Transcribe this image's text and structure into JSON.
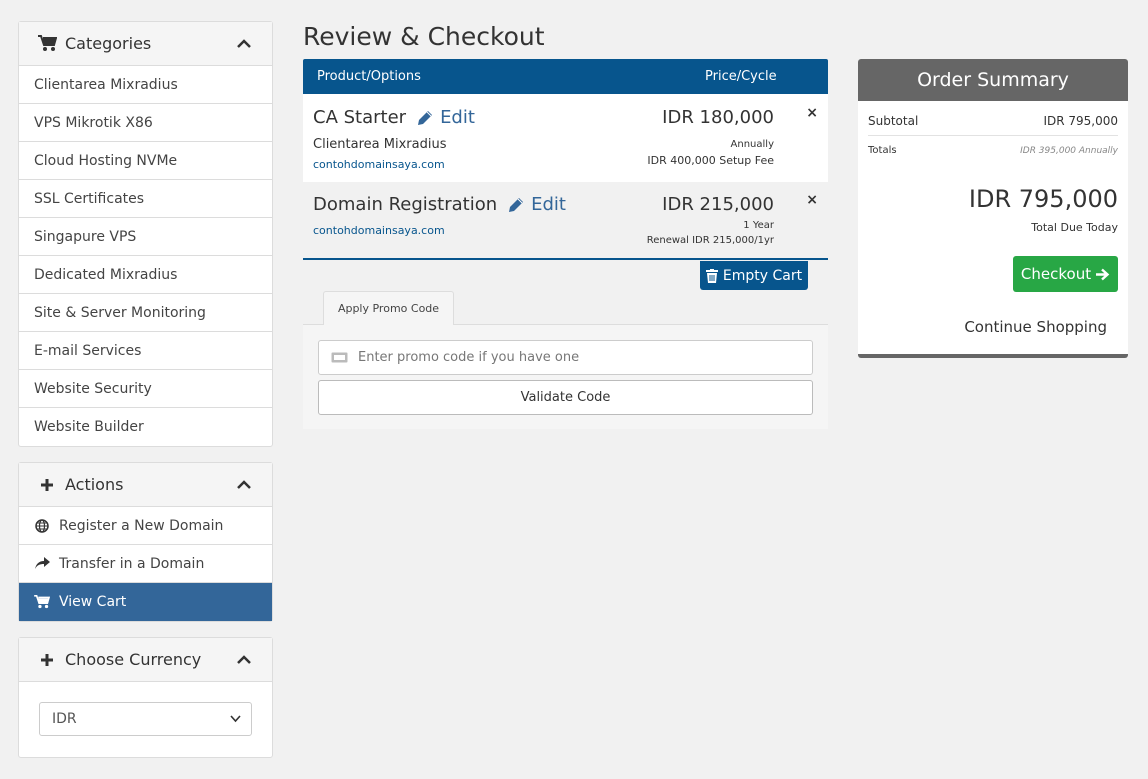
{
  "sidebar": {
    "categories": {
      "title": "Categories",
      "items": [
        {
          "label": "Clientarea Mixradius"
        },
        {
          "label": "VPS Mikrotik X86"
        },
        {
          "label": "Cloud Hosting NVMe"
        },
        {
          "label": "SSL Certificates"
        },
        {
          "label": "Singapure VPS"
        },
        {
          "label": "Dedicated Mixradius"
        },
        {
          "label": "Site & Server Monitoring"
        },
        {
          "label": "E-mail Services"
        },
        {
          "label": "Website Security"
        },
        {
          "label": "Website Builder"
        }
      ]
    },
    "actions": {
      "title": "Actions",
      "items": [
        {
          "label": "Register a New Domain",
          "icon": "globe-icon"
        },
        {
          "label": "Transfer in a Domain",
          "icon": "share-arrow-icon"
        },
        {
          "label": "View Cart",
          "icon": "cart-icon",
          "active": true
        }
      ]
    },
    "currency": {
      "title": "Choose Currency",
      "selected": "IDR"
    }
  },
  "main": {
    "title": "Review & Checkout",
    "cart": {
      "header": {
        "product": "Product/Options",
        "price": "Price/Cycle"
      },
      "edit_label": "Edit",
      "remove_label": "×",
      "items": [
        {
          "name": "CA Starter",
          "group": "Clientarea Mixradius",
          "domain": "contohdomainsaya.com",
          "price": "IDR 180,000",
          "cycle": "Annually",
          "extra": "IDR 400,000 Setup Fee"
        },
        {
          "name": "Domain Registration",
          "domain": "contohdomainsaya.com",
          "price": "IDR 215,000",
          "cycle": "1 Year",
          "extra": "Renewal IDR 215,000/1yr"
        }
      ],
      "empty_cart_label": "Empty Cart"
    },
    "promo": {
      "tab_label": "Apply Promo Code",
      "placeholder": "Enter promo code if you have one",
      "validate_label": "Validate Code"
    }
  },
  "summary": {
    "title": "Order Summary",
    "subtotal_label": "Subtotal",
    "subtotal_value": "IDR 795,000",
    "totals_label": "Totals",
    "totals_annual": "IDR 395,000 Annually",
    "total_due": "IDR 795,000",
    "total_due_label": "Total Due Today",
    "checkout_label": "Checkout",
    "continue_label": "Continue Shopping"
  },
  "colors": {
    "primary": "#07558d",
    "active_nav": "#336699",
    "checkout": "#28a745",
    "summary_header": "#666666"
  }
}
